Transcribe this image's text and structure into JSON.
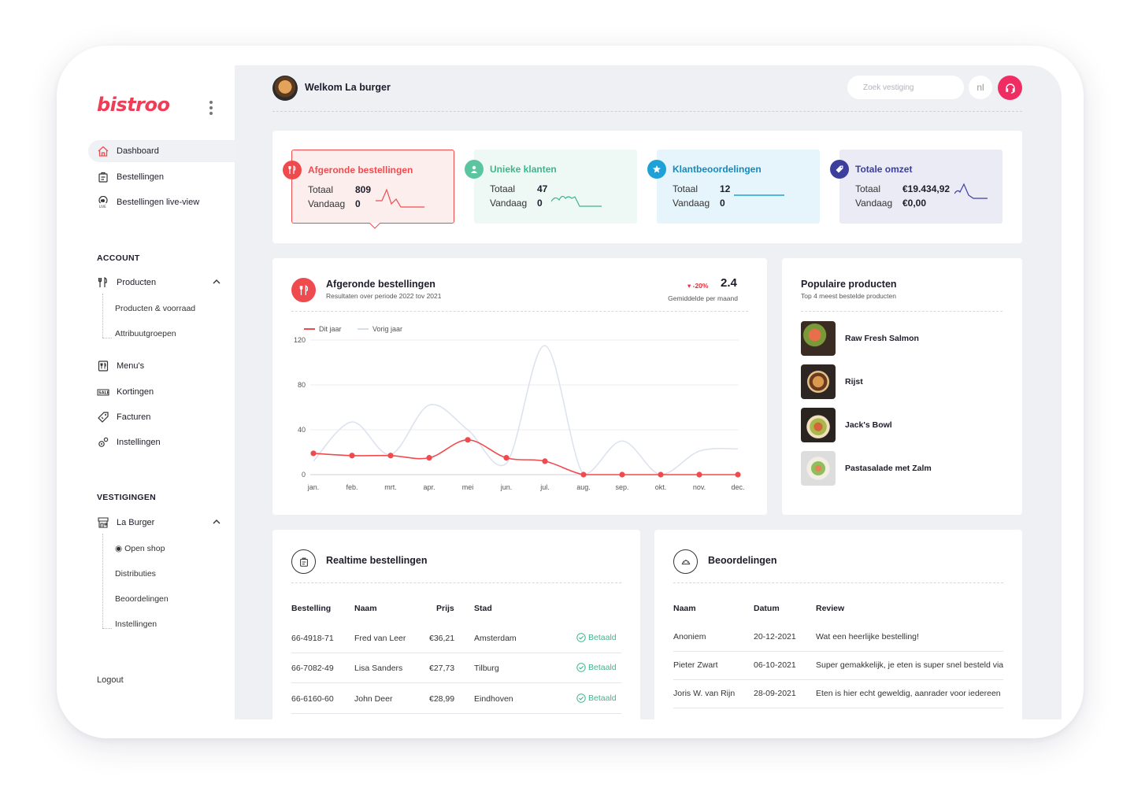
{
  "sidebar": {
    "logo": "bistroo",
    "items": [
      {
        "label": "Dashboard",
        "icon": "home-icon"
      },
      {
        "label": "Bestellingen",
        "icon": "orders-icon"
      },
      {
        "label": "Bestellingen live-view",
        "icon": "live-icon"
      }
    ],
    "account_title": "ACCOUNT",
    "account_items": [
      {
        "label": "Producten",
        "icon": "cutlery-icon"
      },
      {
        "label": "Menu's",
        "icon": "menu-icon"
      },
      {
        "label": "Kortingen",
        "icon": "sale-icon"
      },
      {
        "label": "Facturen",
        "icon": "tag-icon"
      },
      {
        "label": "Instellingen",
        "icon": "gears-icon"
      }
    ],
    "producten_sub": [
      "Producten & voorraad",
      "Attribuutgroepen"
    ],
    "vestigingen_title": "VESTIGINGEN",
    "vestiging": {
      "label": "La Burger",
      "icon": "store-icon"
    },
    "vestiging_sub": [
      "◉ Open shop",
      "Distributies",
      "Beoordelingen",
      "Instellingen"
    ],
    "logout": "Logout"
  },
  "header": {
    "welcome": "Welkom La burger",
    "search_placeholder": "Zoek vestiging",
    "lang": "nl"
  },
  "stats": [
    {
      "title": "Afgeronde bestellingen",
      "totaal_label": "Totaal",
      "totaal": "809",
      "vandaag_label": "Vandaag",
      "vandaag": "0",
      "color": "#ef4b4f"
    },
    {
      "title": "Unieke klanten",
      "totaal_label": "Totaal",
      "totaal": "47",
      "vandaag_label": "Vandaag",
      "vandaag": "0",
      "color": "#3fb58a"
    },
    {
      "title": "Klantbeoordelingen",
      "totaal_label": "Totaal",
      "totaal": "12",
      "vandaag_label": "Vandaag",
      "vandaag": "0",
      "color": "#1da1d6"
    },
    {
      "title": "Totale omzet",
      "totaal_label": "Totaal",
      "totaal": "€19.434,92",
      "vandaag_label": "Vandaag",
      "vandaag": "€0,00",
      "color": "#3b3e9c"
    }
  ],
  "chart_card": {
    "title": "Afgeronde bestellingen",
    "subtitle": "Resultaten over periode 2022 tov 2021",
    "change": "▾ -20%",
    "average": "2.4",
    "average_label": "Gemiddelde per maand",
    "legend_this": "Dit jaar",
    "legend_last": "Vorig jaar"
  },
  "chart_data": {
    "type": "line",
    "categories": [
      "jan.",
      "feb.",
      "mrt.",
      "apr.",
      "mei",
      "jun.",
      "jul.",
      "aug.",
      "sep.",
      "okt.",
      "nov.",
      "dec."
    ],
    "series": [
      {
        "name": "Dit jaar",
        "color": "#ef4b4f",
        "values": [
          19,
          17,
          17,
          15,
          31,
          15,
          12,
          0,
          0,
          0,
          0,
          0
        ]
      },
      {
        "name": "Vorig jaar",
        "color": "#dde3ee",
        "values": [
          12,
          47,
          18,
          62,
          40,
          10,
          115,
          0,
          30,
          0,
          21,
          23
        ]
      }
    ],
    "yticks": [
      0,
      40,
      80,
      120
    ],
    "ylim": [
      0,
      120
    ]
  },
  "popular": {
    "title": "Populaire producten",
    "subtitle": "Top 4 meest bestelde producten",
    "items": [
      "Raw Fresh Salmon",
      "Rijst",
      "Jack's Bowl",
      "Pastasalade met Zalm"
    ]
  },
  "realtime": {
    "title": "Realtime bestellingen",
    "columns": [
      "Bestelling",
      "Naam",
      "Prijs",
      "Stad"
    ],
    "rows": [
      {
        "id": "66-4918-71",
        "name": "Fred van Leer",
        "price": "€36,21",
        "city": "Amsterdam",
        "status": "Betaald"
      },
      {
        "id": "66-7082-49",
        "name": "Lisa Sanders",
        "price": "€27,73",
        "city": "Tilburg",
        "status": "Betaald"
      },
      {
        "id": "66-6160-60",
        "name": "John Deer",
        "price": "€28,99",
        "city": "Eindhoven",
        "status": "Betaald"
      }
    ]
  },
  "reviews": {
    "title": "Beoordelingen",
    "columns": [
      "Naam",
      "Datum",
      "Review"
    ],
    "rows": [
      {
        "name": "Anoniem",
        "date": "20-12-2021",
        "review": "Wat een heerlijke bestelling!"
      },
      {
        "name": "Pieter Zwart",
        "date": "06-10-2021",
        "review": "Super gemakkelijk, je eten is super snel besteld via"
      },
      {
        "name": "Joris W. van Rijn",
        "date": "28-09-2021",
        "review": "Eten is hier echt geweldig, aanrader voor iedereen"
      }
    ]
  }
}
